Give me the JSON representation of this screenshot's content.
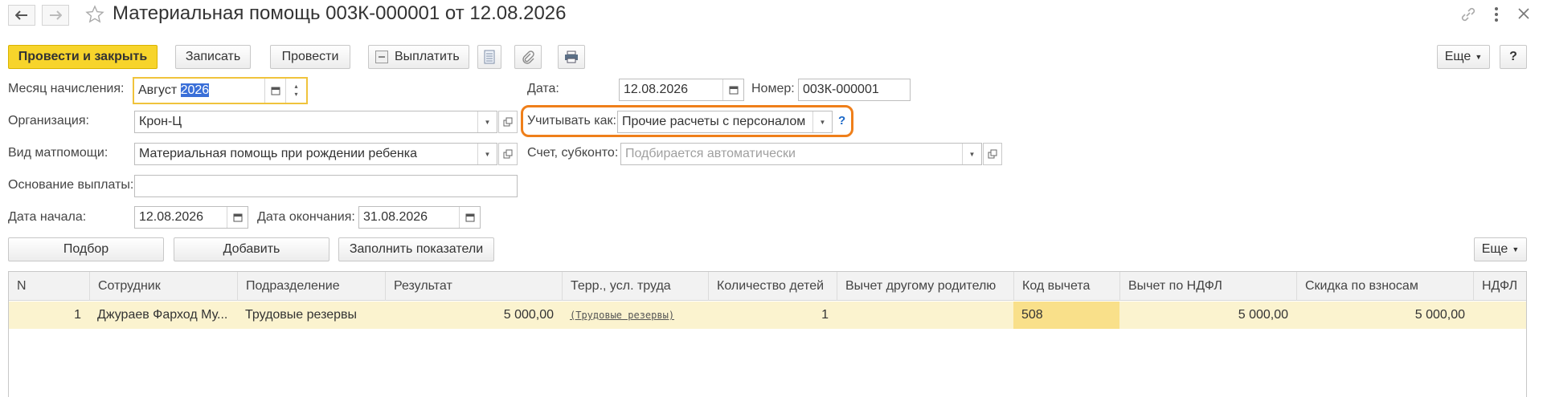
{
  "window": {
    "title": "Материальная помощь 003К-000001 от 12.08.2026"
  },
  "toolbar": {
    "post_close": "Провести и закрыть",
    "save": "Записать",
    "post": "Провести",
    "pay": "Выплатить",
    "more": "Еще",
    "help": "?"
  },
  "form": {
    "month_label": "Месяц начисления:",
    "month_value_plain": "Август ",
    "month_value_selected": "2026",
    "date_label": "Дата:",
    "date_value": "12.08.2026",
    "number_label": "Номер:",
    "number_value": "003К-000001",
    "org_label": "Организация:",
    "org_value": "Крон-Ц",
    "account_as_label": "Учитывать как:",
    "account_as_value": "Прочие расчеты с персоналом",
    "account_help": "?",
    "aid_type_label": "Вид матпомощи:",
    "aid_type_value": "Материальная помощь при рождении ребенка",
    "subconto_label": "Счет, субконто:",
    "subconto_placeholder": "Подбирается автоматически",
    "basis_label": "Основание выплаты:",
    "basis_value": "",
    "start_label": "Дата начала:",
    "start_value": "12.08.2026",
    "end_label": "Дата окончания:",
    "end_value": "31.08.2026"
  },
  "table_toolbar": {
    "pick": "Подбор",
    "add": "Добавить",
    "fill": "Заполнить показатели",
    "more": "Еще"
  },
  "table": {
    "columns": [
      "N",
      "Сотрудник",
      "Подразделение",
      "Результат",
      "Терр., усл. труда",
      "Количество детей",
      "Вычет другому родителю",
      "Код вычета",
      "Вычет по НДФЛ",
      "Скидка по взносам",
      "НДФЛ"
    ],
    "rows": [
      {
        "n": "1",
        "employee": "Джураев Фарход Му...",
        "department": "Трудовые резервы",
        "result": "5 000,00",
        "territory": "(Трудовые резервы)",
        "children": "1",
        "other_parent": "",
        "code": "508",
        "deduction": "5 000,00",
        "discount": "5 000,00",
        "ndfl": ""
      }
    ]
  },
  "colors": {
    "primary_button": "#f7d42b",
    "active_field_border": "#f0c33c",
    "highlight_outline": "#ef7f1a",
    "selected_row": "#fbf3cf",
    "selected_cell": "#f9e08a",
    "text_selection": "#3a6fd8",
    "help_link": "#1a67c7"
  }
}
